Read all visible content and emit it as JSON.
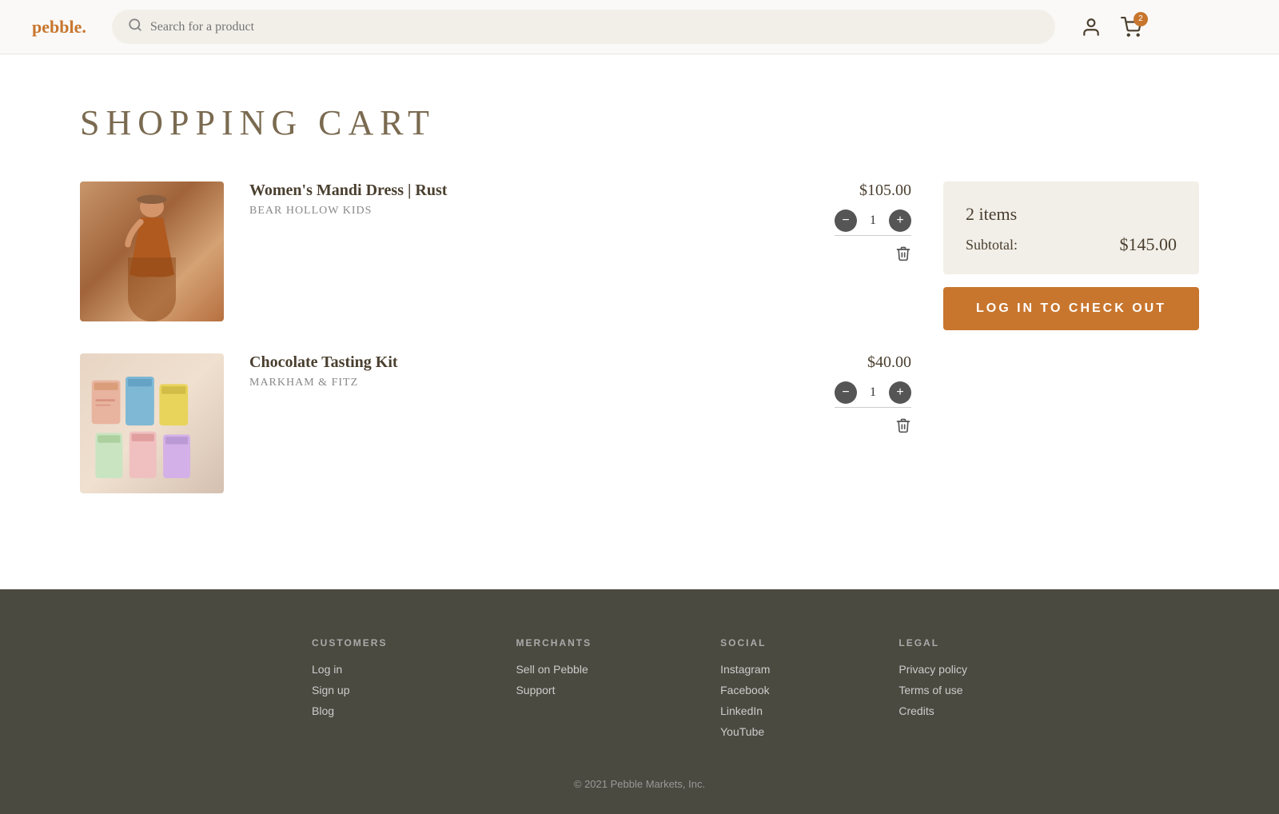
{
  "header": {
    "logo_text": "pebble.",
    "search_placeholder": "Search for a product",
    "cart_badge_count": "2"
  },
  "page": {
    "title": "SHOPPING CART"
  },
  "cart": {
    "items": [
      {
        "id": "item-1",
        "name": "Women's Mandi Dress | Rust",
        "brand": "Bear Hollow Kids",
        "price": "$105.00",
        "quantity": 1,
        "image_type": "dress"
      },
      {
        "id": "item-2",
        "name": "Chocolate Tasting Kit",
        "brand": "MARKHAM & FITZ",
        "price": "$40.00",
        "quantity": 1,
        "image_type": "chocolate"
      }
    ],
    "summary": {
      "items_count": "2 items",
      "subtotal_label": "Subtotal:",
      "subtotal_value": "$145.00",
      "checkout_button_label": "LOG IN TO CHECK OUT"
    }
  },
  "footer": {
    "columns": [
      {
        "heading": "CUSTOMERS",
        "links": [
          "Log in",
          "Sign up",
          "Blog"
        ]
      },
      {
        "heading": "MERCHANTS",
        "links": [
          "Sell on Pebble",
          "Support"
        ]
      },
      {
        "heading": "SOCIAL",
        "links": [
          "Instagram",
          "Facebook",
          "LinkedIn",
          "YouTube"
        ]
      },
      {
        "heading": "LEGAL",
        "links": [
          "Privacy policy",
          "Terms of use",
          "Credits"
        ]
      }
    ],
    "copyright": "© 2021 Pebble Markets, Inc."
  }
}
